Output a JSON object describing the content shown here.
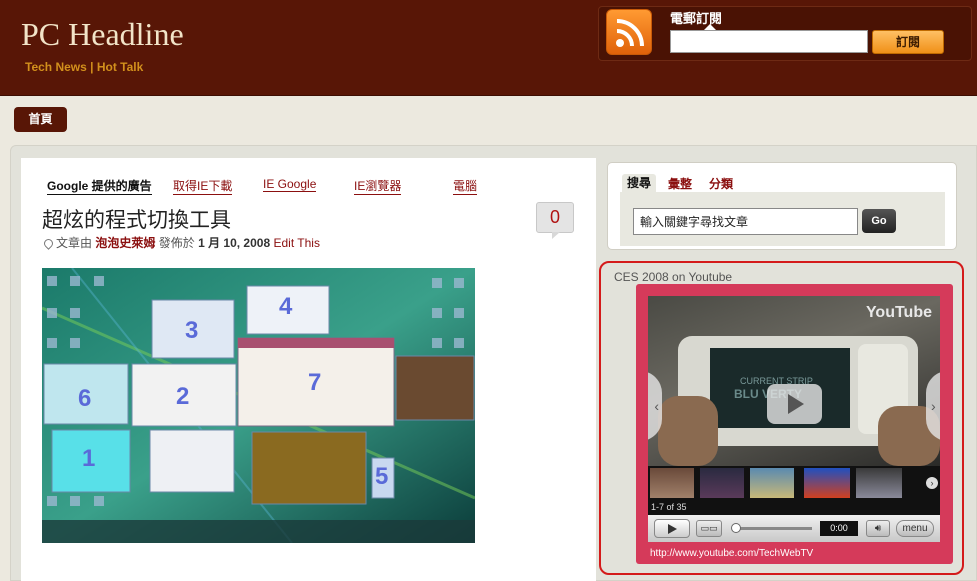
{
  "header": {
    "site_title": "PC Headline",
    "tagline": "Tech News | Hot Talk",
    "subscribe_label": "電郵訂閱",
    "subscribe_button": "訂閱",
    "subscribe_input_value": ""
  },
  "nav": {
    "home": "首頁"
  },
  "ads": {
    "google_label": "Google 提供的廣告",
    "links": [
      "取得IE下載",
      "IE Google",
      "IE瀏覽器",
      "電腦"
    ]
  },
  "post": {
    "title": "超炫的程式切換工具",
    "comment_count": "0",
    "meta_prefix": "文章由",
    "author": "泡泡史萊姆",
    "meta_middle": "發佈於",
    "date": "1 月 10, 2008",
    "edit_label": "Edit This",
    "window_numbers": [
      "3",
      "4",
      "6",
      "2",
      "7",
      "1",
      "5"
    ]
  },
  "sidebar": {
    "tabs": [
      "搜尋",
      "彙整",
      "分類"
    ],
    "search_value": "輸入關鍵字尋找文章",
    "go_label": "Go",
    "video_heading": "CES 2008 on Youtube",
    "youtube_logo": "YouTube",
    "thumb_counter": "1-7 of 35",
    "time": "0:00",
    "menu_label": "menu",
    "url": "http://www.youtube.com/TechWebTV"
  },
  "colors": {
    "header_bg": "#581606",
    "accent_orange": "#f09018",
    "link_red": "#8b0f0f",
    "highlight_red": "#d41a1a",
    "player_pink": "#d53a5a"
  }
}
